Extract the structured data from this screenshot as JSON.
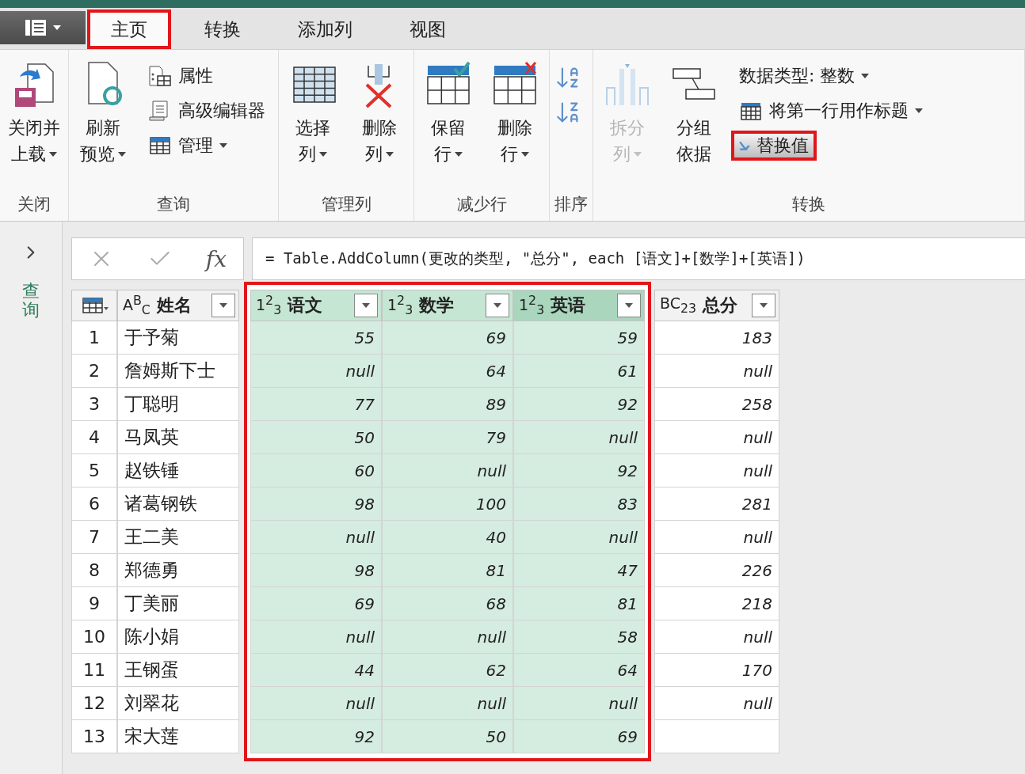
{
  "tabs": [
    {
      "label": "主页",
      "selected": true,
      "annotated": true
    },
    {
      "label": "转换",
      "selected": false,
      "annotated": false
    },
    {
      "label": "添加列",
      "selected": false,
      "annotated": false
    },
    {
      "label": "视图",
      "selected": false,
      "annotated": false
    }
  ],
  "ribbon": [
    {
      "label": "关闭",
      "items": [
        {
          "kind": "large",
          "lines": [
            "关闭并",
            "上载"
          ],
          "dropdown": true,
          "disabled": false
        }
      ]
    },
    {
      "label": "查询",
      "items": [
        {
          "kind": "large",
          "lines": [
            "刷新",
            "预览"
          ],
          "dropdown": true,
          "disabled": false
        },
        {
          "kind": "stack",
          "items": [
            {
              "label": "属性",
              "dropdown": false,
              "annotated": false
            },
            {
              "label": "高级编辑器",
              "dropdown": false,
              "annotated": false
            },
            {
              "label": "管理",
              "dropdown": true,
              "annotated": false
            }
          ]
        }
      ]
    },
    {
      "label": "管理列",
      "items": [
        {
          "kind": "large",
          "lines": [
            "选择",
            "列"
          ],
          "dropdown": true,
          "disabled": false
        },
        {
          "kind": "large",
          "lines": [
            "删除",
            "列"
          ],
          "dropdown": true,
          "disabled": false
        }
      ]
    },
    {
      "label": "减少行",
      "items": [
        {
          "kind": "large",
          "lines": [
            "保留",
            "行"
          ],
          "dropdown": true,
          "disabled": false
        },
        {
          "kind": "large",
          "lines": [
            "删除",
            "行"
          ],
          "dropdown": true,
          "disabled": false
        }
      ]
    },
    {
      "label": "排序",
      "items": [
        {
          "kind": "sort"
        }
      ]
    },
    {
      "label": "转换",
      "items": [
        {
          "kind": "large",
          "lines": [
            "拆分",
            "列"
          ],
          "dropdown": true,
          "disabled": true
        },
        {
          "kind": "large",
          "lines": [
            "分组",
            "依据"
          ],
          "dropdown": false,
          "disabled": false
        },
        {
          "kind": "stack",
          "items": [
            {
              "label": "数据类型: 整数",
              "dropdown": true,
              "annotated": false
            },
            {
              "label": "将第一行用作标题",
              "dropdown": true,
              "annotated": false
            },
            {
              "label": "替换值",
              "dropdown": false,
              "annotated": true
            }
          ]
        }
      ]
    }
  ],
  "nav": {
    "label": "查询"
  },
  "formula_bar": {
    "fx": "fx",
    "formula": "= Table.AddColumn(更改的类型, \"总分\", each [语文]+[数学]+[英语])"
  },
  "table": {
    "columns": [
      {
        "kind": "text",
        "type_mark": "A$^{B}$$_{C}$",
        "name": "姓名",
        "selected": false,
        "focused": false
      },
      {
        "kind": "number",
        "type_mark": "1$^{2}$$_{3}$",
        "name": "语文",
        "selected": true,
        "focused": false
      },
      {
        "kind": "number",
        "type_mark": "1$^{2}$$_{3}$",
        "name": "数学",
        "selected": true,
        "focused": false
      },
      {
        "kind": "number",
        "type_mark": "1$^{2}$$_{3}$",
        "name": "英语",
        "selected": true,
        "focused": true
      },
      {
        "kind": "any",
        "type_mark": "BC$_{23}$",
        "name": "总分",
        "selected": false,
        "focused": false
      }
    ],
    "annotated": true,
    "rows": [
      {
        "number": "1",
        "cells": [
          "于予菊",
          "55",
          "69",
          "59",
          "183"
        ]
      },
      {
        "number": "2",
        "cells": [
          "詹姆斯下士",
          "null",
          "64",
          "61",
          "null"
        ]
      },
      {
        "number": "3",
        "cells": [
          "丁聪明",
          "77",
          "89",
          "92",
          "258"
        ]
      },
      {
        "number": "4",
        "cells": [
          "马凤英",
          "50",
          "79",
          "null",
          "null"
        ]
      },
      {
        "number": "5",
        "cells": [
          "赵铁锤",
          "60",
          "null",
          "92",
          "null"
        ]
      },
      {
        "number": "6",
        "cells": [
          "诸葛钢铁",
          "98",
          "100",
          "83",
          "281"
        ]
      },
      {
        "number": "7",
        "cells": [
          "王二美",
          "null",
          "40",
          "null",
          "null"
        ]
      },
      {
        "number": "8",
        "cells": [
          "郑德勇",
          "98",
          "81",
          "47",
          "226"
        ]
      },
      {
        "number": "9",
        "cells": [
          "丁美丽",
          "69",
          "68",
          "81",
          "218"
        ]
      },
      {
        "number": "10",
        "cells": [
          "陈小娟",
          "null",
          "null",
          "58",
          "null"
        ]
      },
      {
        "number": "11",
        "cells": [
          "王钢蛋",
          "44",
          "62",
          "64",
          "170"
        ]
      },
      {
        "number": "12",
        "cells": [
          "刘翠花",
          "null",
          "null",
          "null",
          "null"
        ]
      },
      {
        "number": "13",
        "cells": [
          "宋大莲",
          "92",
          "50",
          "69"
        ]
      }
    ]
  }
}
